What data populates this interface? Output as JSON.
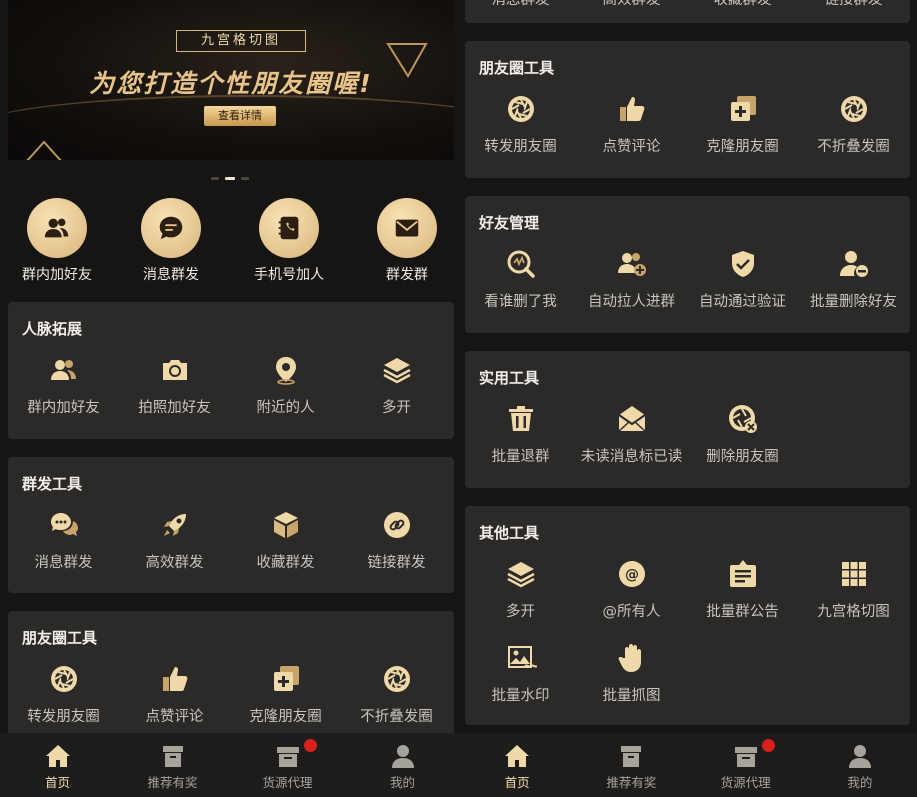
{
  "banner": {
    "tag": "九宫格切图",
    "slogan": "为您打造个性朋友圈喔!",
    "button": "查看详情"
  },
  "quick_actions": [
    {
      "label": "群内加好友",
      "icon": "users-icon"
    },
    {
      "label": "消息群发",
      "icon": "chat-bubble-icon"
    },
    {
      "label": "手机号加人",
      "icon": "phone-book-icon"
    },
    {
      "label": "群发群",
      "icon": "envelope-icon"
    }
  ],
  "left_sections": {
    "network": {
      "title": "人脉拓展",
      "items": [
        {
          "label": "群内加好友",
          "icon": "users-icon"
        },
        {
          "label": "拍照加好友",
          "icon": "camera-icon"
        },
        {
          "label": "附近的人",
          "icon": "location-pin-icon"
        },
        {
          "label": "多开",
          "icon": "layers-icon"
        }
      ]
    },
    "broadcast": {
      "title": "群发工具",
      "items": [
        {
          "label": "消息群发",
          "icon": "chat-bubbles-icon"
        },
        {
          "label": "高效群发",
          "icon": "rocket-icon"
        },
        {
          "label": "收藏群发",
          "icon": "cube-icon"
        },
        {
          "label": "链接群发",
          "icon": "link-icon"
        }
      ]
    },
    "moments": {
      "title": "朋友圈工具",
      "items": [
        {
          "label": "转发朋友圈",
          "icon": "aperture-icon"
        },
        {
          "label": "点赞评论",
          "icon": "thumbs-up-icon"
        },
        {
          "label": "克隆朋友圈",
          "icon": "clone-icon"
        },
        {
          "label": "不折叠发圈",
          "icon": "aperture-icon"
        }
      ]
    }
  },
  "right_top_partial": [
    "消息群发",
    "高效群发",
    "收藏群发",
    "链接群发"
  ],
  "right_sections": {
    "moments": {
      "title": "朋友圈工具",
      "items": [
        {
          "label": "转发朋友圈",
          "icon": "aperture-icon"
        },
        {
          "label": "点赞评论",
          "icon": "thumbs-up-icon"
        },
        {
          "label": "克隆朋友圈",
          "icon": "clone-icon"
        },
        {
          "label": "不折叠发圈",
          "icon": "aperture-icon"
        }
      ]
    },
    "friends": {
      "title": "好友管理",
      "items": [
        {
          "label": "看谁删了我",
          "icon": "search-icon"
        },
        {
          "label": "自动拉人进群",
          "icon": "add-users-icon"
        },
        {
          "label": "自动通过验证",
          "icon": "shield-check-icon"
        },
        {
          "label": "批量删除好友",
          "icon": "remove-user-icon"
        }
      ]
    },
    "utility": {
      "title": "实用工具",
      "items": [
        {
          "label": "批量退群",
          "icon": "trash-icon"
        },
        {
          "label": "未读消息标已读",
          "icon": "open-mail-icon"
        },
        {
          "label": "删除朋友圈",
          "icon": "aperture-delete-icon"
        }
      ]
    },
    "other": {
      "title": "其他工具",
      "items": [
        {
          "label": "多开",
          "icon": "layers-icon"
        },
        {
          "label": "@所有人",
          "icon": "at-sign-icon"
        },
        {
          "label": "批量群公告",
          "icon": "notice-board-icon"
        },
        {
          "label": "九宫格切图",
          "icon": "grid-icon"
        },
        {
          "label": "批量水印",
          "icon": "image-icon"
        },
        {
          "label": "批量抓图",
          "icon": "hand-icon"
        }
      ]
    }
  },
  "nav": [
    {
      "label": "首页",
      "icon": "home-icon",
      "active": true
    },
    {
      "label": "推荐有奖",
      "icon": "gift-box-icon",
      "active": false
    },
    {
      "label": "货源代理",
      "icon": "box-icon",
      "active": false,
      "badge": true
    },
    {
      "label": "我的",
      "icon": "user-icon",
      "active": false
    }
  ],
  "colors": {
    "accent": "#e8c48a",
    "card": "#2b2a28",
    "background": "#161513",
    "badge": "#d8201c"
  }
}
